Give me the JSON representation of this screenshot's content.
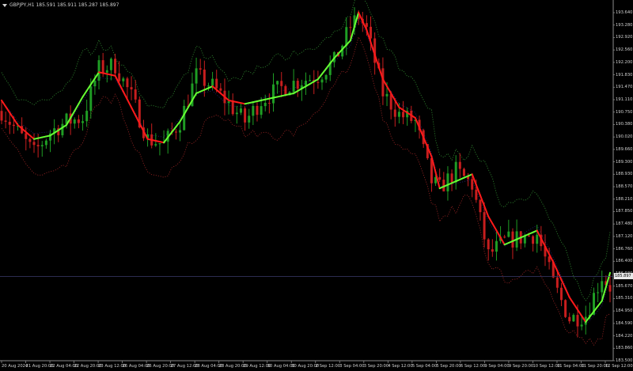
{
  "chart": {
    "symbol_line": "GBPJPY,H1  185.591 185.911 185.287 185.897",
    "current_price": "185.897",
    "colors": {
      "background": "#000000",
      "bull": "#1f9d24",
      "bear": "#c81e1e",
      "ma_up": "#66ff33",
      "ma_down": "#ff1a1a",
      "band_upper": "#2a7a2a",
      "band_lower": "#8a2020",
      "band_mid": "#23237a",
      "axis": "#8c8c8c"
    }
  },
  "price_axis": {
    "labels": [
      "193.640",
      "193.280",
      "192.920",
      "192.560",
      "192.200",
      "191.830",
      "191.470",
      "191.110",
      "190.750",
      "190.380",
      "190.020",
      "189.660",
      "189.300",
      "188.930",
      "188.570",
      "188.210",
      "187.850",
      "187.480",
      "187.120",
      "186.760",
      "186.400",
      "186.030",
      "185.670",
      "185.310",
      "184.950",
      "184.590",
      "184.220",
      "183.860",
      "183.500"
    ]
  },
  "time_axis": {
    "labels": [
      "20 Aug 2024",
      "21 Aug 20:00",
      "22 Aug 04:00",
      "22 Aug 20:00",
      "23 Aug 12:00",
      "26 Aug 04:00",
      "26 Aug 20:00",
      "27 Aug 12:00",
      "28 Aug 04:00",
      "28 Aug 20:00",
      "29 Aug 12:00",
      "30 Aug 04:00",
      "30 Aug 20:00",
      "2 Sep 12:00",
      "3 Sep 04:00",
      "3 Sep 20:00",
      "4 Sep 12:00",
      "5 Sep 04:00",
      "5 Sep 20:00",
      "6 Sep 12:00",
      "9 Sep 04:00",
      "9 Sep 20:00",
      "10 Sep 12:00",
      "11 Sep 04:00",
      "11 Sep 20:00",
      "12 Sep 12:00"
    ]
  },
  "chart_data": {
    "type": "candlestick",
    "x_range": [
      "20 Aug 2024",
      "12 Sep 12:00"
    ],
    "ylim": [
      183.5,
      193.64
    ],
    "current_price": 185.897,
    "path": [
      [
        0,
        190.6
      ],
      [
        4,
        190.0
      ],
      [
        8,
        189.4
      ],
      [
        12,
        190.0
      ],
      [
        16,
        190.3
      ],
      [
        20,
        190.4
      ],
      [
        24,
        191.8
      ],
      [
        28,
        191.9
      ],
      [
        32,
        191.0
      ],
      [
        36,
        189.8
      ],
      [
        40,
        189.65
      ],
      [
        44,
        190.3
      ],
      [
        48,
        191.6
      ],
      [
        52,
        191.3
      ],
      [
        56,
        190.8
      ],
      [
        60,
        190.3
      ],
      [
        64,
        190.9
      ],
      [
        68,
        191.2
      ],
      [
        72,
        191.4
      ],
      [
        78,
        191.6
      ],
      [
        82,
        192.0
      ],
      [
        86,
        193.0
      ],
      [
        88,
        193.3
      ],
      [
        90,
        192.9
      ],
      [
        94,
        191.1
      ],
      [
        98,
        190.5
      ],
      [
        102,
        190.3
      ],
      [
        106,
        188.6
      ],
      [
        108,
        188.4
      ],
      [
        112,
        188.9
      ],
      [
        116,
        188.5
      ],
      [
        120,
        186.5
      ],
      [
        124,
        186.9
      ],
      [
        128,
        187.0
      ],
      [
        132,
        187.1
      ],
      [
        136,
        185.7
      ],
      [
        140,
        184.7
      ],
      [
        144,
        184.8
      ],
      [
        148,
        185.9
      ],
      [
        150,
        185.6
      ]
    ],
    "ma_path": [
      [
        0,
        190.9
      ],
      [
        4,
        190.2
      ],
      [
        8,
        189.8
      ],
      [
        12,
        189.9
      ],
      [
        16,
        190.2
      ],
      [
        20,
        191.0
      ],
      [
        24,
        191.7
      ],
      [
        28,
        191.6
      ],
      [
        32,
        190.7
      ],
      [
        36,
        189.8
      ],
      [
        40,
        189.7
      ],
      [
        44,
        190.3
      ],
      [
        48,
        191.1
      ],
      [
        52,
        191.3
      ],
      [
        56,
        190.9
      ],
      [
        60,
        190.8
      ],
      [
        64,
        190.9
      ],
      [
        68,
        191.0
      ],
      [
        72,
        191.1
      ],
      [
        78,
        191.5
      ],
      [
        82,
        192.1
      ],
      [
        86,
        192.6
      ],
      [
        88,
        193.4
      ],
      [
        90,
        192.9
      ],
      [
        94,
        191.5
      ],
      [
        98,
        190.7
      ],
      [
        102,
        190.4
      ],
      [
        106,
        189.3
      ],
      [
        108,
        188.4
      ],
      [
        112,
        188.6
      ],
      [
        116,
        188.8
      ],
      [
        120,
        187.6
      ],
      [
        124,
        186.8
      ],
      [
        128,
        187.0
      ],
      [
        132,
        187.2
      ],
      [
        136,
        186.3
      ],
      [
        140,
        185.3
      ],
      [
        144,
        184.6
      ],
      [
        148,
        185.2
      ],
      [
        150,
        186.0
      ]
    ]
  }
}
